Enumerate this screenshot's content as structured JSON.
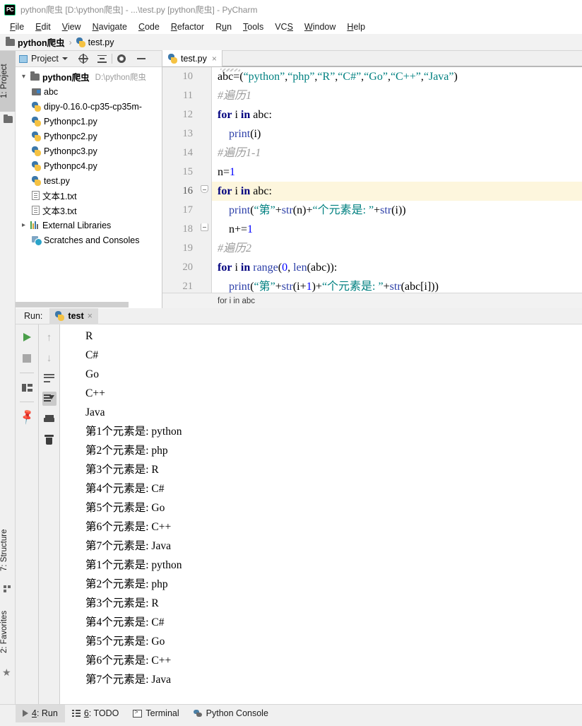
{
  "window": {
    "title": "python爬虫 [D:\\python爬虫] - ...\\test.py [python爬虫] - PyCharm",
    "logo_text": "PC",
    "logo_name": "pycharm-logo-icon"
  },
  "menubar": {
    "items": [
      {
        "label": "File",
        "accel": "F"
      },
      {
        "label": "Edit",
        "accel": "E"
      },
      {
        "label": "View",
        "accel": "V"
      },
      {
        "label": "Navigate",
        "accel": "N"
      },
      {
        "label": "Code",
        "accel": "C"
      },
      {
        "label": "Refactor",
        "accel": "R"
      },
      {
        "label": "Run",
        "accel": "u"
      },
      {
        "label": "Tools",
        "accel": "T"
      },
      {
        "label": "VCS",
        "accel": "S"
      },
      {
        "label": "Window",
        "accel": "W"
      },
      {
        "label": "Help",
        "accel": "H"
      }
    ]
  },
  "breadcrumb": {
    "project": "python爬虫",
    "separator": "›",
    "file": "test.py"
  },
  "left_toolwindows": {
    "project_tab": "1: Project",
    "structure_tab": "7: Structure",
    "favorites_tab": "2: Favorites"
  },
  "project_panel": {
    "title": "Project",
    "toolbar": [
      "locate-icon",
      "collapse-all-icon",
      "settings-icon",
      "hide-icon"
    ],
    "tree": [
      {
        "label": "python爬虫",
        "path": "D:\\python爬虫",
        "icon": "folder-icon",
        "expanded": true,
        "depth": 0,
        "bold": true
      },
      {
        "label": "abc",
        "icon": "folder-module-icon",
        "depth": 1
      },
      {
        "label": "dipy-0.16.0-cp35-cp35m-",
        "icon": "python-unknown-icon",
        "depth": 1
      },
      {
        "label": "Pythonpc1.py",
        "icon": "python-file-icon",
        "depth": 1
      },
      {
        "label": "Pythonpc2.py",
        "icon": "python-file-icon",
        "depth": 1
      },
      {
        "label": "Pythonpc3.py",
        "icon": "python-file-icon",
        "depth": 1
      },
      {
        "label": "Pythonpc4.py",
        "icon": "python-file-icon",
        "depth": 1
      },
      {
        "label": "test.py",
        "icon": "python-file-icon",
        "depth": 1
      },
      {
        "label": "文本1.txt",
        "icon": "text-file-icon",
        "depth": 1
      },
      {
        "label": "文本3.txt",
        "icon": "text-file-icon",
        "depth": 1
      },
      {
        "label": "External Libraries",
        "icon": "libraries-icon",
        "expanded": false,
        "depth": 0
      },
      {
        "label": "Scratches and Consoles",
        "icon": "scratches-icon",
        "depth": 0
      }
    ]
  },
  "editor": {
    "tab": {
      "label": "test.py",
      "icon": "python-file-icon",
      "close": "×"
    },
    "status_hint": "for i in abc",
    "highlighted_line": 16,
    "lines": [
      {
        "no": "10",
        "tokens": [
          {
            "t": "abc=(",
            "c": "pl"
          },
          {
            "t": "“python”",
            "c": "s"
          },
          {
            "t": ",",
            "c": "pl"
          },
          {
            "t": "“php”",
            "c": "s"
          },
          {
            "t": ",",
            "c": "pl"
          },
          {
            "t": "“R”",
            "c": "s"
          },
          {
            "t": ",",
            "c": "pl"
          },
          {
            "t": "“C#”",
            "c": "s"
          },
          {
            "t": ",",
            "c": "pl"
          },
          {
            "t": "“Go”",
            "c": "s"
          },
          {
            "t": ",",
            "c": "pl"
          },
          {
            "t": "“C++”",
            "c": "s"
          },
          {
            "t": ",",
            "c": "pl"
          },
          {
            "t": "“Java”",
            "c": "s"
          },
          {
            "t": ")",
            "c": "pl"
          }
        ]
      },
      {
        "no": "11",
        "tokens": [
          {
            "t": "#遍历1",
            "c": "cm"
          }
        ]
      },
      {
        "no": "12",
        "tokens": [
          {
            "t": "for",
            "c": "k"
          },
          {
            "t": " i ",
            "c": "pl"
          },
          {
            "t": "in",
            "c": "k"
          },
          {
            "t": " abc:",
            "c": "pl"
          }
        ]
      },
      {
        "no": "13",
        "tokens": [
          {
            "t": "    ",
            "c": "pl"
          },
          {
            "t": "print",
            "c": "fn"
          },
          {
            "t": "(i)",
            "c": "pl"
          }
        ]
      },
      {
        "no": "14",
        "tokens": [
          {
            "t": "#遍历1-1",
            "c": "cm"
          }
        ]
      },
      {
        "no": "15",
        "tokens": [
          {
            "t": "n=",
            "c": "pl"
          },
          {
            "t": "1",
            "c": "nu"
          }
        ]
      },
      {
        "no": "16",
        "tokens": [
          {
            "t": "for",
            "c": "k"
          },
          {
            "t": " i ",
            "c": "pl"
          },
          {
            "t": "in",
            "c": "k"
          },
          {
            "t": " abc:",
            "c": "pl"
          }
        ]
      },
      {
        "no": "17",
        "tokens": [
          {
            "t": "    ",
            "c": "pl"
          },
          {
            "t": "print",
            "c": "fn"
          },
          {
            "t": "(",
            "c": "pl"
          },
          {
            "t": "“第”",
            "c": "s"
          },
          {
            "t": "+",
            "c": "pl"
          },
          {
            "t": "str",
            "c": "fn"
          },
          {
            "t": "(n)+",
            "c": "pl"
          },
          {
            "t": "“个元素是: ”",
            "c": "s"
          },
          {
            "t": "+",
            "c": "pl"
          },
          {
            "t": "str",
            "c": "fn"
          },
          {
            "t": "(i))",
            "c": "pl"
          }
        ]
      },
      {
        "no": "18",
        "tokens": [
          {
            "t": "    n+=",
            "c": "pl"
          },
          {
            "t": "1",
            "c": "nu"
          }
        ]
      },
      {
        "no": "19",
        "tokens": [
          {
            "t": "#遍历2",
            "c": "cm"
          }
        ]
      },
      {
        "no": "20",
        "tokens": [
          {
            "t": "for",
            "c": "k"
          },
          {
            "t": " i ",
            "c": "pl"
          },
          {
            "t": "in",
            "c": "k"
          },
          {
            "t": " ",
            "c": "pl"
          },
          {
            "t": "range",
            "c": "fn"
          },
          {
            "t": "(",
            "c": "pl"
          },
          {
            "t": "0",
            "c": "nu"
          },
          {
            "t": ", ",
            "c": "pl"
          },
          {
            "t": "len",
            "c": "fn"
          },
          {
            "t": "(abc)):",
            "c": "pl"
          }
        ]
      },
      {
        "no": "21",
        "tokens": [
          {
            "t": "    ",
            "c": "pl"
          },
          {
            "t": "print",
            "c": "fn"
          },
          {
            "t": "(",
            "c": "pl"
          },
          {
            "t": "“第”",
            "c": "s"
          },
          {
            "t": "+",
            "c": "pl"
          },
          {
            "t": "str",
            "c": "fn"
          },
          {
            "t": "(i+",
            "c": "pl"
          },
          {
            "t": "1",
            "c": "nu"
          },
          {
            "t": ")+",
            "c": "pl"
          },
          {
            "t": "“个元素是: ”",
            "c": "s"
          },
          {
            "t": "+",
            "c": "pl"
          },
          {
            "t": "str",
            "c": "fn"
          },
          {
            "t": "(abc[i]))",
            "c": "pl"
          }
        ]
      }
    ]
  },
  "run_panel": {
    "label": "Run:",
    "tab": {
      "label": "test",
      "icon": "python-run-icon",
      "close": "×"
    },
    "tools_left": [
      "rerun-icon",
      "stop-icon",
      "layout-icon",
      "pin-icon"
    ],
    "tools_right": [
      "up-arrow-icon",
      "down-arrow-icon",
      "soft-wrap-icon",
      "scroll-to-end-icon",
      "print-icon",
      "clear-all-icon"
    ],
    "console_lines": [
      "R",
      "C#",
      "Go",
      "C++",
      "Java",
      "第1个元素是: python",
      "第2个元素是: php",
      "第3个元素是: R",
      "第4个元素是: C#",
      "第5个元素是: Go",
      "第6个元素是: C++",
      "第7个元素是: Java",
      "第1个元素是: python",
      "第2个元素是: php",
      "第3个元素是: R",
      "第4个元素是: C#",
      "第5个元素是: Go",
      "第6个元素是: C++",
      "第7个元素是: Java"
    ]
  },
  "statusbar": {
    "items": [
      {
        "label": "4: Run",
        "accel": "4",
        "icon": "run-icon",
        "active": true
      },
      {
        "label": "6: TODO",
        "accel": "6",
        "icon": "todo-icon",
        "active": false
      },
      {
        "label": "Terminal",
        "icon": "terminal-icon",
        "active": false
      },
      {
        "label": "Python Console",
        "icon": "python-console-icon",
        "active": false
      }
    ]
  },
  "colors": {
    "accent_green": "#21d789",
    "keyword": "#00007f",
    "string": "#008080",
    "function": "#2c3fa8",
    "number": "#0000ff",
    "comment": "#9b9b9b",
    "highlight_line": "#fdf6dd"
  }
}
